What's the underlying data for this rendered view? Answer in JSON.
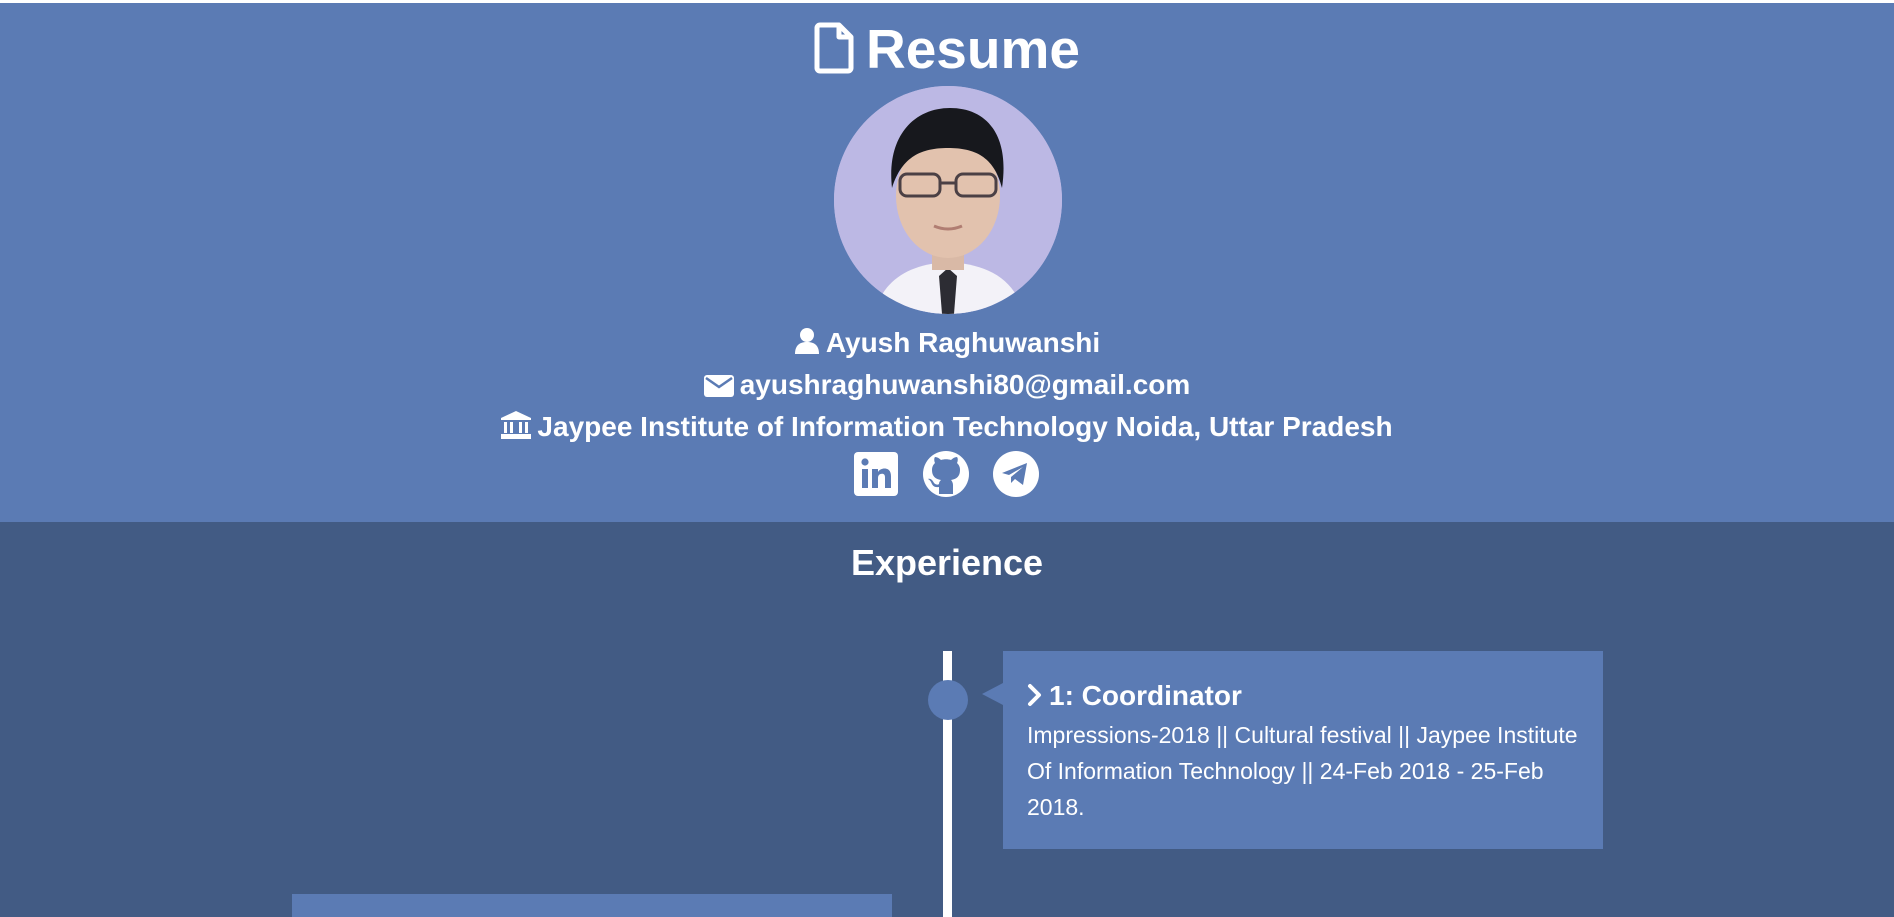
{
  "header": {
    "title": "Resume",
    "name": "Ayush Raghuwanshi",
    "email": "ayushraghuwanshi80@gmail.com",
    "institute": "Jaypee Institute of Information Technology Noida, Uttar Pradesh",
    "icons": [
      "file-icon",
      "user-icon",
      "envelope-icon",
      "university-icon"
    ],
    "socials": [
      "linkedin-icon",
      "github-icon",
      "telegram-icon"
    ]
  },
  "experience": {
    "title": "Experience",
    "items": [
      {
        "heading": "1: Coordinator",
        "description": "Impressions-2018 || Cultural festival || Jaypee Institute Of Information Technology || 24-Feb 2018 - 25-Feb 2018."
      }
    ]
  },
  "colors": {
    "header_bg": "#5b7bb4",
    "page_bg": "#425b84",
    "text": "#ffffff"
  }
}
